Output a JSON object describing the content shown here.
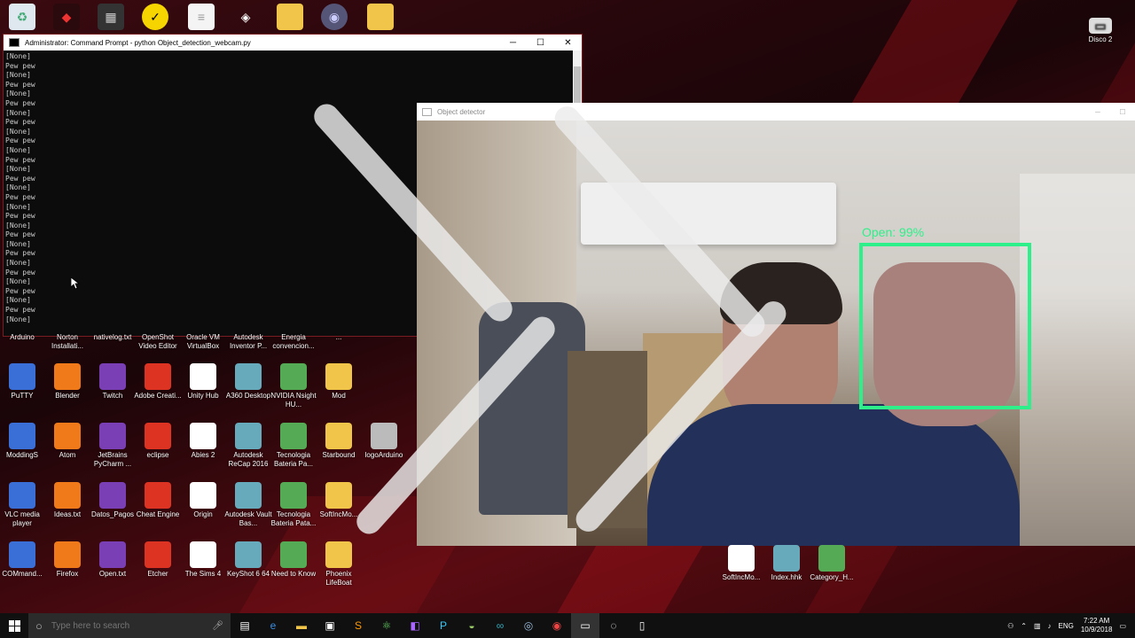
{
  "cmd": {
    "title": "Administrator: Command Prompt - python  Object_detection_webcam.py",
    "lines": [
      "[None]",
      "Pew pew",
      "[None]",
      "Pew pew",
      "[None]",
      "Pew pew",
      "[None]",
      "Pew pew",
      "[None]",
      "Pew pew",
      "[None]",
      "Pew pew",
      "[None]",
      "Pew pew",
      "[None]",
      "Pew pew",
      "[None]",
      "Pew pew",
      "[None]",
      "Pew pew",
      "[None]",
      "Pew pew",
      "[None]",
      "Pew pew",
      "[None]",
      "Pew pew",
      "[None]",
      "Pew pew",
      "[None]"
    ]
  },
  "detector": {
    "title": "Object detector",
    "label": "Open: 99%"
  },
  "top_icons": [
    "recycle-bin-icon",
    "predator-icon",
    "chip-icon",
    "norton-icon",
    "document-icon",
    "unity-icon",
    "folder-icon",
    "logo-icon",
    "folder-icon"
  ],
  "disco": "Disco 2",
  "partial_row": [
    "Arduino",
    "Norton Installati...",
    "nativelog.txt",
    "OpenShot Video Editor",
    "Oracle VM VirtualBox",
    "Autodesk Inventor P...",
    "Energia convencion...",
    "..."
  ],
  "desktop_rows": [
    [
      "PuTTY",
      "Blender",
      "Twitch",
      "Adobe Creati...",
      "Unity Hub",
      "A360 Desktop",
      "NVIDIA Nsight HU...",
      "Mod"
    ],
    [
      "ModdingS",
      "Atom",
      "JetBrains PyCharm ...",
      "eclipse",
      "Abies 2",
      "Autodesk ReCap 2016",
      "Tecnologia Bateria Pa...",
      "Starbound",
      "logoArduino"
    ],
    [
      "VLC media player",
      "Ideas.txt",
      "Datos_Pagos",
      "Cheat Engine",
      "Origin",
      "Autodesk Vault Bas...",
      "Tecnologia Bateria Pata...",
      "SoftIncMo..."
    ],
    [
      "COMmand...",
      "Firefox",
      "Open.txt",
      "Etcher",
      "The Sims 4",
      "KeyShot 6 64",
      "Need to Know",
      "Phoenix LifeBoat"
    ]
  ],
  "right_icons": [
    "SoftIncMo...",
    "Index.hhk",
    "Category_H..."
  ],
  "taskbar": {
    "search_placeholder": "Type here to search",
    "lang": "ENG",
    "time": "7:22 AM",
    "date": "10/9/2018"
  },
  "colors": {
    "bbox": "#2ef08a",
    "taskbar": "#101010"
  }
}
